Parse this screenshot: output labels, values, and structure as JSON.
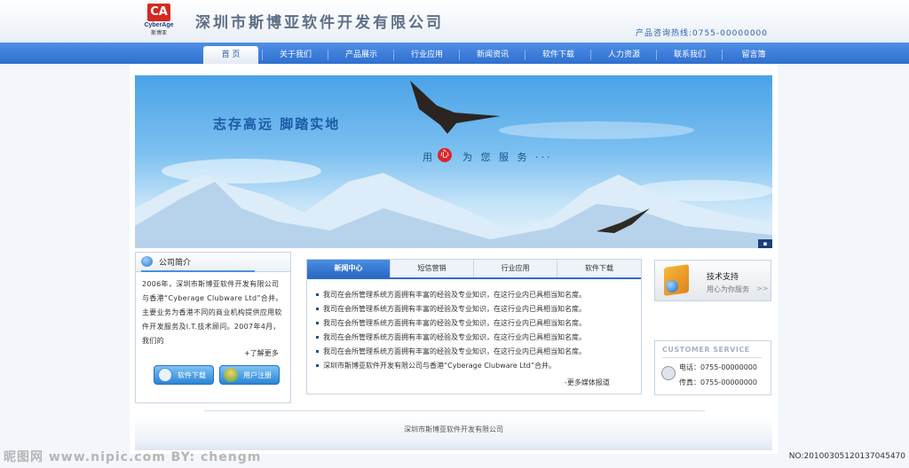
{
  "header": {
    "logo": {
      "mark": "CA",
      "brand": "CyberAge",
      "sub": "斯博亚"
    },
    "company_name": "深圳市斯博亚软件开发有限公司",
    "hotline": "产品咨询热线:0755-00000000"
  },
  "nav": {
    "items": [
      {
        "label": "首 页",
        "active": true
      },
      {
        "label": "关于我们"
      },
      {
        "label": "产品展示"
      },
      {
        "label": "行业应用"
      },
      {
        "label": "新闻资讯"
      },
      {
        "label": "软件下载"
      },
      {
        "label": "人力资源"
      },
      {
        "label": "联系我们"
      },
      {
        "label": "留言簿"
      }
    ]
  },
  "banner": {
    "slogan": "志存高远  脚踏实地",
    "service_before": "用",
    "service_heart": "心",
    "service_after": "为 您 服 务 ···"
  },
  "about": {
    "title": "公司简介",
    "text": "2006年，深圳市斯博亚软件开发有限公司与香港“Cyberage Clubware Ltd”合并。主要业务为香港不同的商业机构提供应用软件开发服务及I.T.技术顾问。2007年4月，我们的",
    "more": "+了解更多",
    "download_button": "软件下载",
    "register_button": "用户注册"
  },
  "news": {
    "tabs": [
      "新闻中心",
      "短信营销",
      "行业应用",
      "软件下载"
    ],
    "items": [
      "我司在会所管理系统方面拥有丰富的经验及专业知识，在这行业内已具相当知名度。",
      "我司在会所管理系统方面拥有丰富的经验及专业知识，在这行业内已具相当知名度。",
      "我司在会所管理系统方面拥有丰富的经验及专业知识，在这行业内已具相当知名度。",
      "我司在会所管理系统方面拥有丰富的经验及专业知识，在这行业内已具相当知名度。",
      "我司在会所管理系统方面拥有丰富的经验及专业知识，在这行业内已具相当知名度。",
      "深圳市斯博亚软件开发有限公司与香港“Cyberage Clubware Ltd”合并。"
    ],
    "more": "-更多媒体报道"
  },
  "support": {
    "title": "技术支持",
    "subtitle": "用心为你服务",
    "arrow": ">>"
  },
  "service": {
    "title": "CUSTOMER SERVICE",
    "tel": "电话：0755-00000000",
    "fax": "传真：0755-00000000"
  },
  "footer": {
    "text": "深圳市斯博亚软件开发有限公司"
  },
  "watermark": {
    "left": "昵图网 www.nipic.com   BY: chengm",
    "right": "NO:20100305120137045470"
  },
  "colors": {
    "nav": "#3a7ad8",
    "accent": "#2d6fc5",
    "heart": "#d9262a"
  }
}
